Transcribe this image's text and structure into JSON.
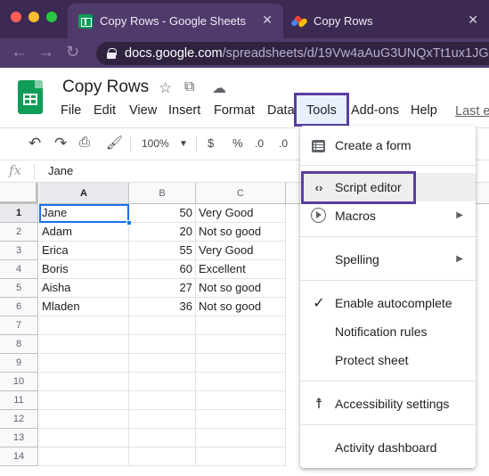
{
  "browser": {
    "tabs": [
      {
        "title": "Copy Rows - Google Sheets",
        "close": "✕"
      },
      {
        "title": "Copy Rows",
        "close": "✕"
      }
    ],
    "url": {
      "host": "docs.google.com",
      "path": "/spreadsheets/d/19Vw4aAuG3UNQxTt1ux1JG"
    }
  },
  "document": {
    "title": "Copy Rows",
    "menu": [
      "File",
      "Edit",
      "View",
      "Insert",
      "Format",
      "Data",
      "Tools",
      "Add-ons",
      "Help"
    ],
    "last_edit": "Last e"
  },
  "toolbar": {
    "zoom": "100%",
    "currency": "$",
    "percent": "%",
    "decimal": ".0",
    "decimal2": ".0"
  },
  "formula_bar": {
    "fx": "fx",
    "value": "Jane"
  },
  "grid": {
    "columns": [
      "A",
      "B",
      "C"
    ],
    "rows": [
      "1",
      "2",
      "3",
      "4",
      "5",
      "6",
      "7",
      "8",
      "9",
      "10",
      "11",
      "12",
      "13",
      "14"
    ],
    "data": [
      {
        "a": "Jane",
        "b": "50",
        "c": "Very Good"
      },
      {
        "a": "Adam",
        "b": "20",
        "c": "Not so good"
      },
      {
        "a": "Erica",
        "b": "55",
        "c": "Very Good"
      },
      {
        "a": "Boris",
        "b": "60",
        "c": "Excellent"
      },
      {
        "a": "Aisha",
        "b": "27",
        "c": "Not so good"
      },
      {
        "a": "Mladen",
        "b": "36",
        "c": "Not so good"
      }
    ]
  },
  "tools_menu": {
    "create_form": "Create a form",
    "script_editor": "Script editor",
    "macros": "Macros",
    "spelling": "Spelling",
    "enable_autocomplete": "Enable autocomplete",
    "notification_rules": "Notification rules",
    "protect_sheet": "Protect sheet",
    "accessibility": "Accessibility settings",
    "activity_dashboard": "Activity dashboard"
  },
  "colors": {
    "highlight_box": "#5a3e9e",
    "sheets_green": "#0f9d58",
    "selection_blue": "#1a73e8"
  }
}
